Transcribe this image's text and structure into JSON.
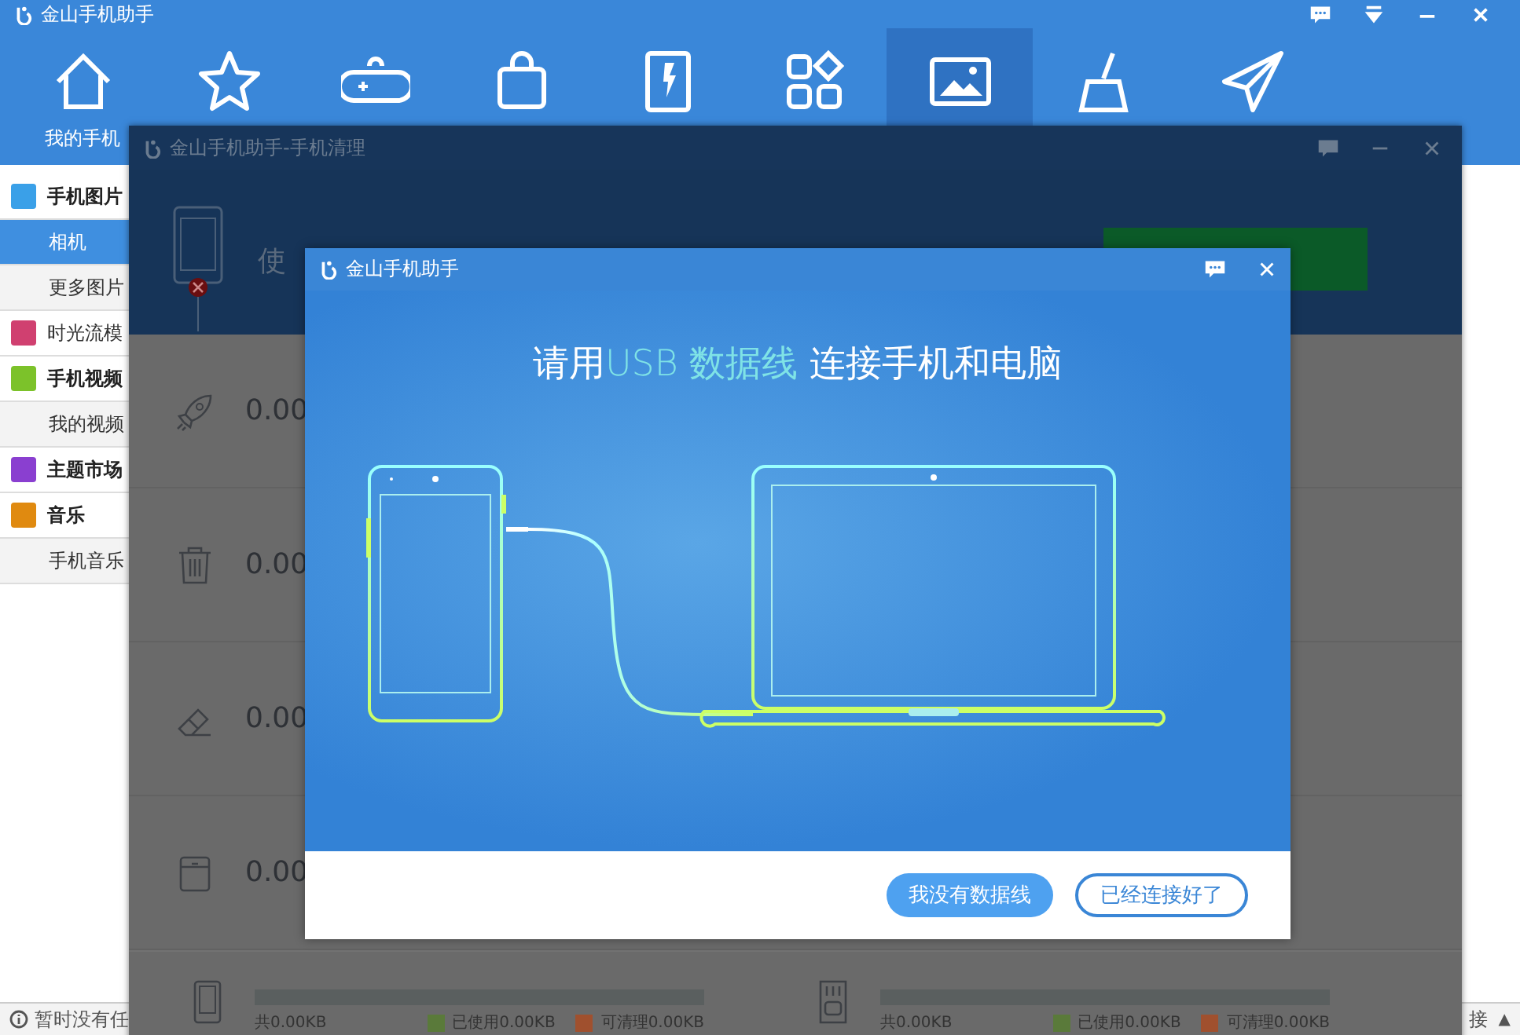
{
  "app": {
    "title": "金山手机助手",
    "toolbar": [
      {
        "label": "我的手机",
        "selected": false
      },
      {
        "selected": false
      },
      {
        "selected": false
      },
      {
        "selected": false
      },
      {
        "selected": false
      },
      {
        "selected": false
      },
      {
        "selected": true
      },
      {
        "selected": false
      },
      {
        "selected": false
      }
    ]
  },
  "sidebar": [
    {
      "kind": "header",
      "label": "手机图片",
      "selected": false
    },
    {
      "kind": "sub",
      "label": "相机",
      "selected": true
    },
    {
      "kind": "sub",
      "label": "更多图片",
      "selected": false
    },
    {
      "kind": "item",
      "label": "时光流模",
      "selected": false
    },
    {
      "kind": "header",
      "label": "手机视频",
      "selected": false
    },
    {
      "kind": "sub",
      "label": "我的视频",
      "selected": false
    },
    {
      "kind": "header",
      "label": "主题市场",
      "selected": false
    },
    {
      "kind": "header",
      "label": "音乐",
      "selected": false
    },
    {
      "kind": "sub",
      "label": "手机音乐",
      "selected": false
    }
  ],
  "status_bar": {
    "left": "暂时没有任",
    "right": "接",
    "arrow": "▲"
  },
  "cleanup_window": {
    "title": "金山手机助手-手机清理",
    "header_text": "使",
    "rows": [
      {
        "value": "0.00"
      },
      {
        "value": "0.00"
      },
      {
        "value": "0.00"
      },
      {
        "value": "0.00"
      }
    ],
    "storage": [
      {
        "total": "共0.00KB",
        "used": "已使用0.00KB",
        "cleanable": "可清理0.00KB",
        "level": 0
      },
      {
        "total": "共0.00KB",
        "used": "已使用0.00KB",
        "cleanable": "可清理0.00KB",
        "level": 0
      }
    ]
  },
  "usb_dialog": {
    "title": "金山手机助手",
    "heading_prefix": "请用",
    "heading_highlight": "USB 数据线",
    "heading_suffix": "连接手机和电脑",
    "buttons": [
      {
        "kind": "primary",
        "label": "我没有数据线"
      },
      {
        "kind": "outline",
        "label": "已经连接好了"
      }
    ]
  }
}
